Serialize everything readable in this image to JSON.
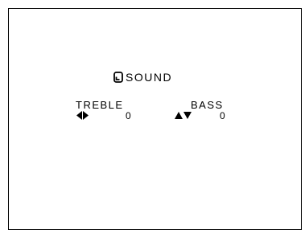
{
  "menu": {
    "title": "SOUND",
    "title_icon": "sound-menu-icon"
  },
  "treble": {
    "label": "TREBLE",
    "value": "0",
    "adjust_icon": "left-right-arrows-icon"
  },
  "bass": {
    "label": "BASS",
    "value": "0",
    "adjust_icon": "up-down-arrows-icon"
  },
  "colors": {
    "background": "#ffffff",
    "foreground": "#000000"
  }
}
